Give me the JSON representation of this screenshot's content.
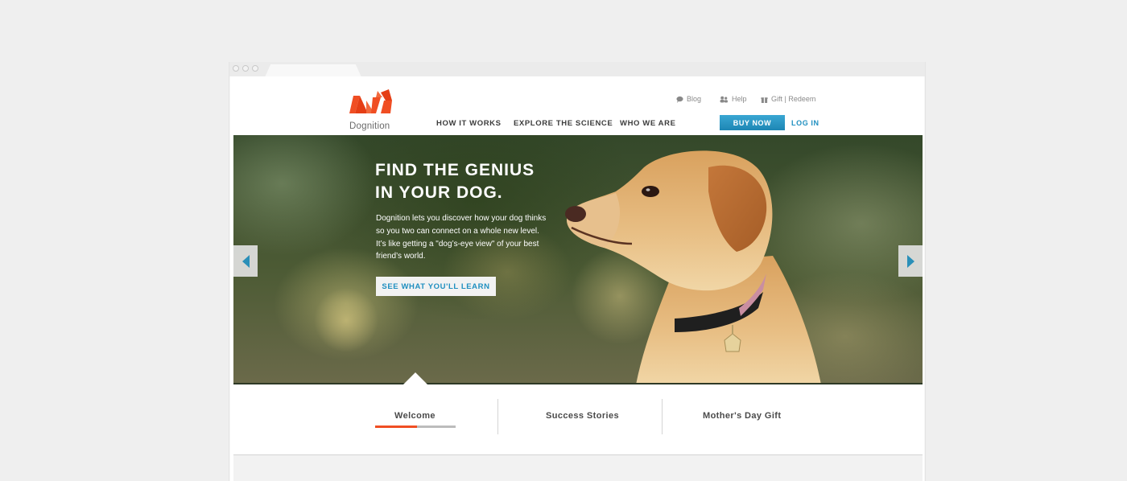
{
  "brand": {
    "name": "Dognition",
    "color_primary": "#f04e23",
    "color_accent": "#1f8fc0"
  },
  "utility_links": [
    {
      "label": "Blog",
      "icon": "chat-icon"
    },
    {
      "label": "Help",
      "icon": "people-icon"
    },
    {
      "label": "Gift | Redeem",
      "icon": "gift-icon"
    }
  ],
  "nav": {
    "items": [
      "HOW IT WORKS",
      "EXPLORE THE SCIENCE",
      "WHO WE ARE"
    ],
    "buy_label": "BUY NOW",
    "login_label": "LOG IN"
  },
  "hero": {
    "title_line1": "FIND THE GENIUS",
    "title_line2": "IN YOUR DOG.",
    "body": "Dognition lets you discover how your dog thinks so you two can connect on a whole new level. It’s like getting a \"dog’s-eye view\" of your best friend’s world.",
    "cta_label": "SEE WHAT YOU'LL LEARN",
    "prev_icon": "chevron-left-icon",
    "next_icon": "chevron-right-icon"
  },
  "tabs": {
    "items": [
      "Welcome",
      "Success Stories",
      "Mother's Day Gift"
    ],
    "active_index": 0,
    "progress": 0.52
  }
}
